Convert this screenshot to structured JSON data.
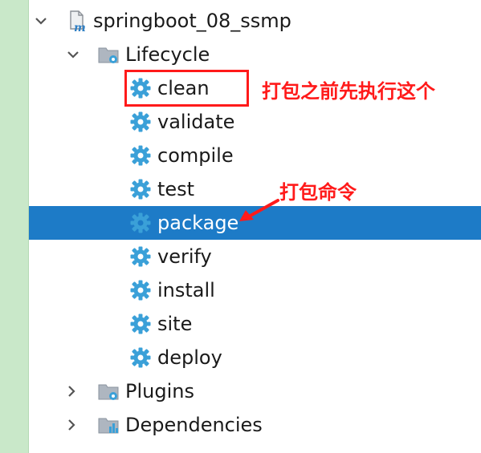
{
  "project": {
    "name": "springboot_08_ssmp"
  },
  "lifecycle": {
    "label": "Lifecycle",
    "goals": [
      {
        "label": "clean"
      },
      {
        "label": "validate"
      },
      {
        "label": "compile"
      },
      {
        "label": "test"
      },
      {
        "label": "package",
        "selected": true
      },
      {
        "label": "verify"
      },
      {
        "label": "install"
      },
      {
        "label": "site"
      },
      {
        "label": "deploy"
      }
    ]
  },
  "plugins": {
    "label": "Plugins"
  },
  "dependencies": {
    "label": "Dependencies"
  },
  "annotations": {
    "clean_note": "打包之前先执行这个",
    "package_note": "打包命令"
  },
  "colors": {
    "selection": "#1d7bc7",
    "gear": "#3aa0d8",
    "annotation": "#ff1a1a",
    "gutter": "#c9e8c9"
  },
  "icons": {
    "expanded": "chevron-down-icon",
    "collapsed": "chevron-right-icon",
    "project": "maven-project-icon",
    "folder": "folder-gear-icon",
    "goal": "gear-icon",
    "dependencies": "dependencies-icon"
  }
}
